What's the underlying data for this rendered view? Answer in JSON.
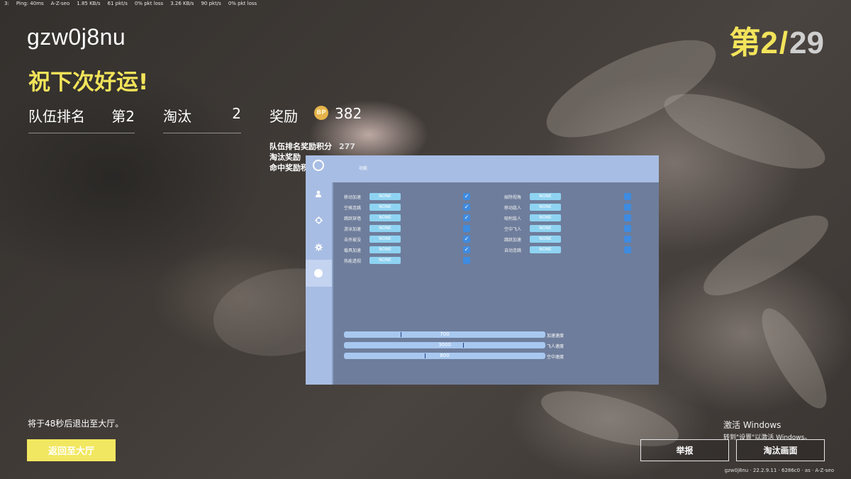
{
  "netbar": [
    "3:",
    "Ping: 40ms",
    "A-Z-seo",
    "1.85 KB/s",
    "61 pkt/s",
    "0% pkt loss",
    "3.26 KB/s",
    "90 pkt/s",
    "0% pkt loss"
  ],
  "player": {
    "name": "gzw0j8nu"
  },
  "result": {
    "message": "祝下次好运!"
  },
  "rank": {
    "current": "第2",
    "separator": "/",
    "total": "29"
  },
  "stats": {
    "team_rank_label": "队伍排名",
    "team_rank_value": "第2",
    "kills_label": "淘汰",
    "kills_value": "2",
    "reward_label": "奖励",
    "reward_value": "382",
    "coin_text": "BP"
  },
  "breakdown": [
    {
      "label": "队伍排名奖励积分",
      "value": "277"
    },
    {
      "label": "淘汰奖励",
      "value": ""
    },
    {
      "label": "命中奖励积",
      "value": ""
    }
  ],
  "cheat_menu": {
    "title": "功能",
    "left_options": [
      {
        "label": "移动加速",
        "key": "NONE",
        "checked": true
      },
      {
        "label": "空格连跳",
        "key": "NONE",
        "checked": true
      },
      {
        "label": "跳跃穿墙",
        "key": "NONE",
        "checked": true
      },
      {
        "label": "游泳加速",
        "key": "NONE",
        "checked": false
      },
      {
        "label": "击杀被没",
        "key": "NONE",
        "checked": true
      },
      {
        "label": "载具加速",
        "key": "NONE",
        "checked": true
      },
      {
        "label": "热能透视",
        "key": "NONE",
        "checked": false
      }
    ],
    "right_options": [
      {
        "label": "娱除视角",
        "key": "NONE",
        "checked": false
      },
      {
        "label": "移动敌人",
        "key": "NONE",
        "checked": false
      },
      {
        "label": "吸附敌人",
        "key": "NONE",
        "checked": false
      },
      {
        "label": "空中飞人",
        "key": "NONE",
        "checked": false
      },
      {
        "label": "跳跃加速",
        "key": "NONE",
        "checked": false
      },
      {
        "label": "自动连跳",
        "key": "NONE",
        "checked": false
      }
    ],
    "sliders": [
      {
        "value": "700",
        "label": "加速速度",
        "fraction": 0.28
      },
      {
        "value": "3000",
        "label": "飞人速度",
        "fraction": 0.59
      },
      {
        "value": "800",
        "label": "空中速度",
        "fraction": 0.4
      }
    ],
    "side_icons": [
      "circle-icon",
      "user-icon",
      "crosshair-icon",
      "gear-icon",
      "dot-icon"
    ]
  },
  "exit": {
    "timer_text": "将于48秒后退出至大厅。",
    "lobby_button": "返回至大厅"
  },
  "buttons": {
    "report": "举报",
    "spectate": "淘汰画面"
  },
  "windows_activation": {
    "line1": "激活 Windows",
    "line2": "转到\"设置\"以激活 Windows。"
  },
  "version": "gzw0j8nu · 22.2.9.11 · 6286c0 · as · A-Z-seo",
  "colors": {
    "accent_yellow": "#f2e45a",
    "panel_bg": "#6e7d9b",
    "panel_header": "#a8bde3",
    "checkbox": "#3f8be0",
    "key_chip": "#8fd3f2"
  }
}
